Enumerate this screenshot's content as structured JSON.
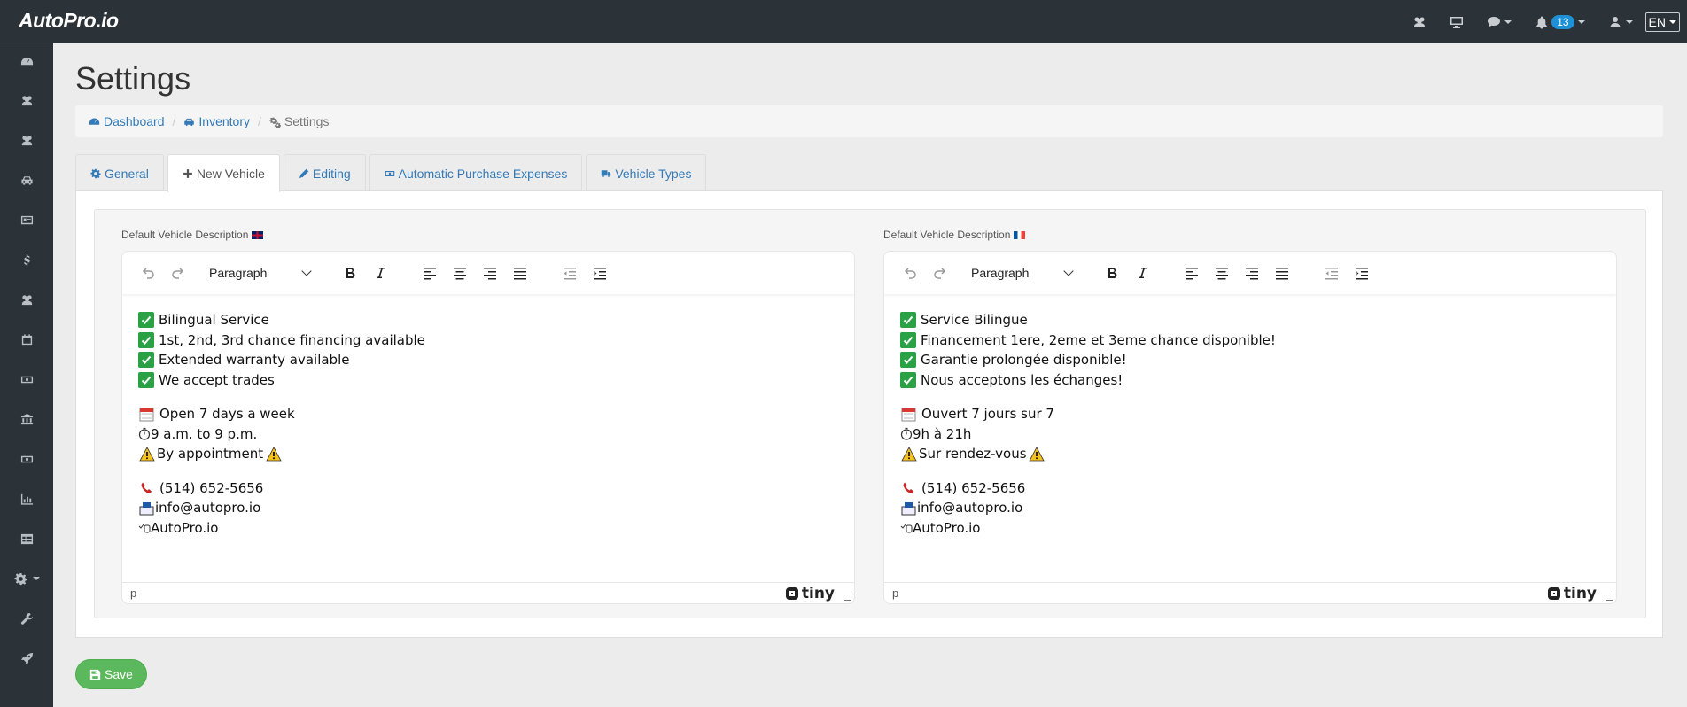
{
  "app": {
    "logo_main": "AutoPro",
    "logo_suffix": ".io"
  },
  "topbar": {
    "notifications_count": "13",
    "language": "EN"
  },
  "page": {
    "title": "Settings"
  },
  "breadcrumb": {
    "dashboard": "Dashboard",
    "inventory": "Inventory",
    "settings": "Settings",
    "separator": "/"
  },
  "tabs": [
    {
      "label": "General",
      "icon": "gear-icon"
    },
    {
      "label": "New Vehicle",
      "icon": "plus-icon"
    },
    {
      "label": "Editing",
      "icon": "pencil-icon"
    },
    {
      "label": "Automatic Purchase Expenses",
      "icon": "money-icon"
    },
    {
      "label": "Vehicle Types",
      "icon": "truck-icon"
    }
  ],
  "editors": {
    "english": {
      "label": "Default Vehicle Description",
      "format": "Paragraph",
      "checklist": [
        "Bilingual Service",
        "1st, 2nd, 3rd chance financing available",
        "Extended warranty available",
        "We accept trades"
      ],
      "hours": [
        "Open 7 days a week",
        "9 a.m. to 9 p.m.",
        "By appointment"
      ],
      "contact": [
        "(514) 652-5656",
        "info@autopro.io",
        "AutoPro.io"
      ],
      "status_path": "p",
      "brand": "tiny"
    },
    "french": {
      "label": "Default Vehicle Description",
      "format": "Paragraph",
      "checklist": [
        "Service Bilingue",
        "Financement 1ere, 2eme et 3eme chance disponible!",
        "Garantie prolongée disponible!",
        "Nous acceptons les échanges!"
      ],
      "hours": [
        "Ouvert 7 jours sur 7",
        "9h à 21h",
        "Sur rendez-vous"
      ],
      "contact": [
        "(514) 652-5656",
        "info@autopro.io",
        "AutoPro.io"
      ],
      "status_path": "p",
      "brand": "tiny"
    }
  },
  "actions": {
    "save_label": "Save"
  },
  "colors": {
    "accent": "#337ab7",
    "topbar": "#2b3238",
    "save": "#5cb85c",
    "badge": "#1e90d6"
  }
}
